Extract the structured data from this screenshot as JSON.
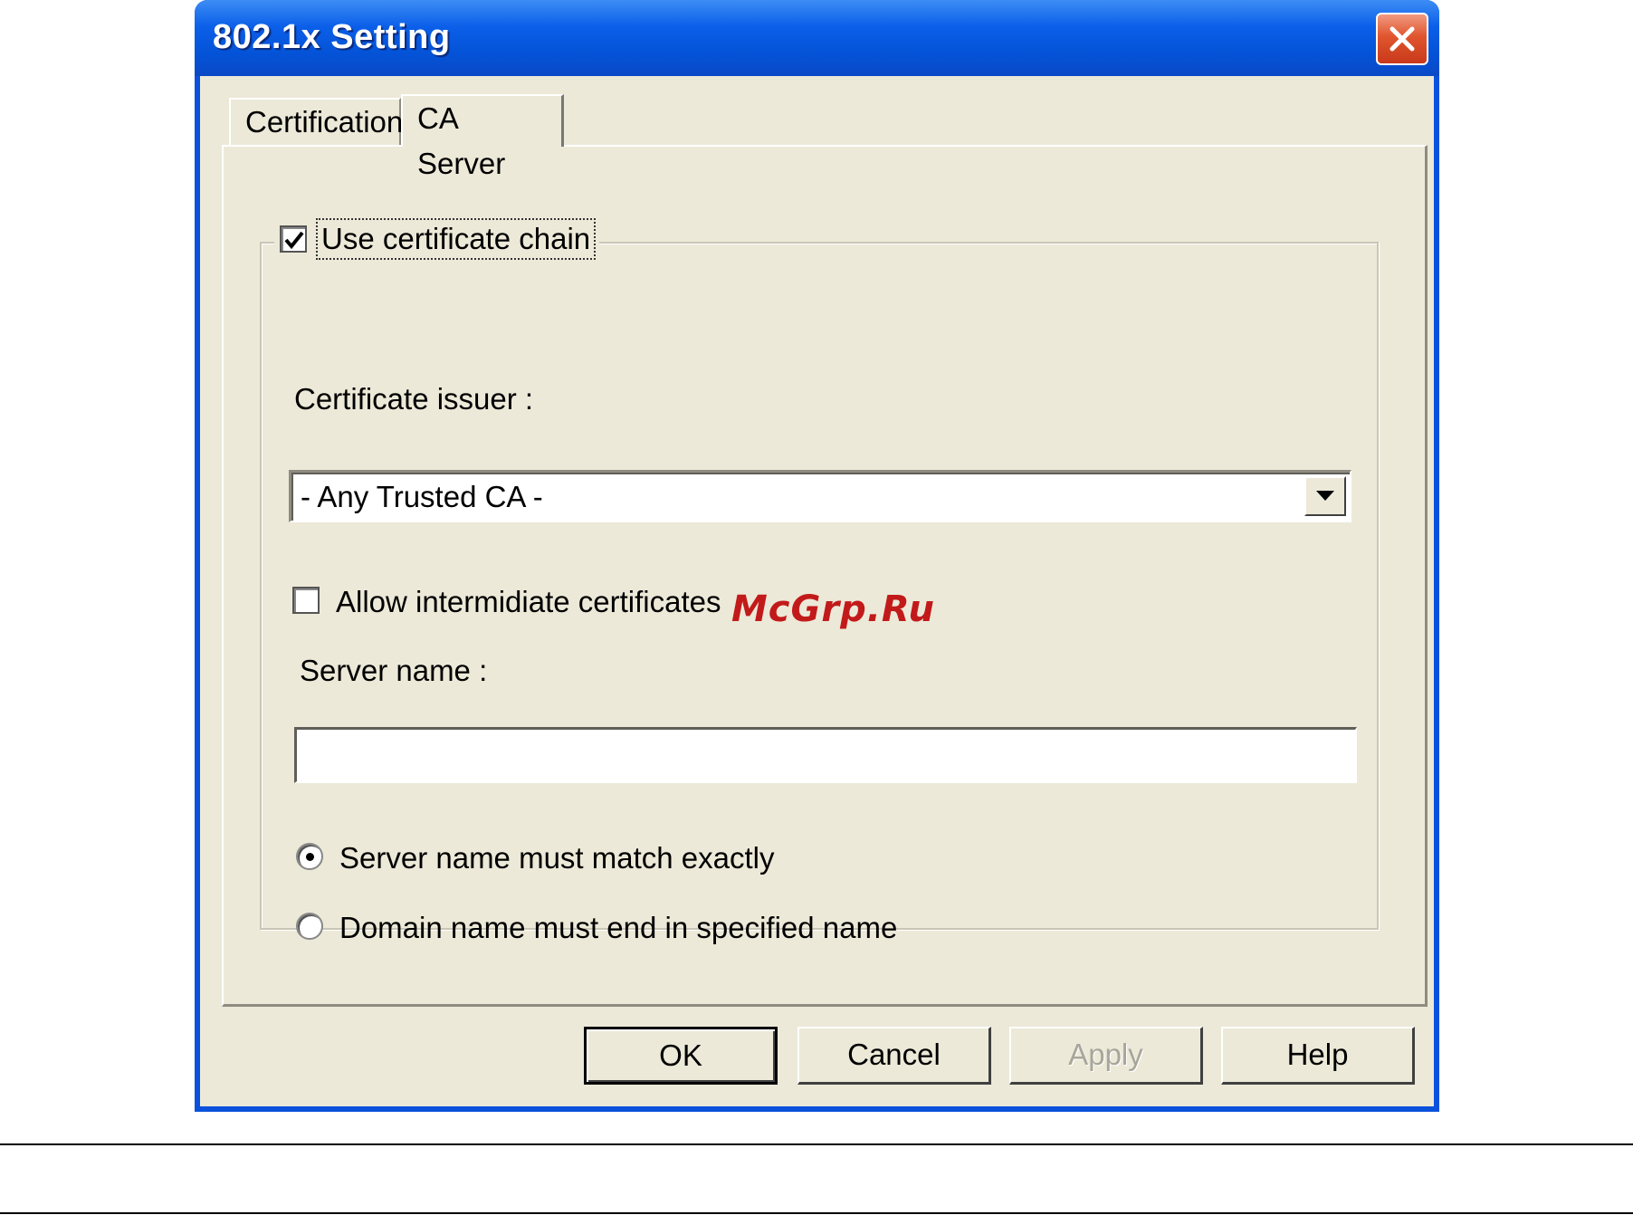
{
  "window": {
    "title": "802.1x Setting",
    "close_icon": "close-icon"
  },
  "tabs": [
    {
      "label": "Certification",
      "selected": false
    },
    {
      "label": "CA Server",
      "selected": true
    }
  ],
  "group": {
    "use_certificate_chain": {
      "label": "Use certificate chain",
      "checked": true
    },
    "certificate_issuer_label": "Certificate issuer :",
    "certificate_issuer_value": "- Any Trusted CA -",
    "allow_intermediate": {
      "label": "Allow intermidiate certificates",
      "checked": false
    },
    "server_name_label": "Server name :",
    "server_name_value": "",
    "radio_options": [
      {
        "label": "Server name must match exactly",
        "selected": true
      },
      {
        "label": "Domain name must end in specified name",
        "selected": false
      }
    ]
  },
  "buttons": {
    "ok": "OK",
    "cancel": "Cancel",
    "apply": "Apply",
    "help": "Help"
  },
  "watermark": "McGrp.Ru",
  "colors": {
    "titlebar": "#0453d8",
    "dialog_bg": "#ece9d8",
    "close_button": "#e0552e",
    "watermark": "#c21a1a"
  }
}
